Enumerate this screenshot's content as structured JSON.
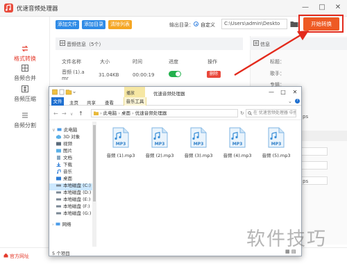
{
  "app": {
    "title": "优速音频处理器",
    "window_buttons": [
      "—",
      "□",
      "✕"
    ]
  },
  "toolbar": {
    "add_file": "添加文件",
    "add_dir": "添加目录",
    "clear_list": "清除列表",
    "output_label": "输出目录：",
    "custom_radio": "自定义",
    "output_path": "C:\\Users\\admin\\Deskto",
    "start_button": "开始转换"
  },
  "sidebar": {
    "items": [
      {
        "label": "格式转换",
        "active": true
      },
      {
        "label": "音频合并",
        "active": false
      },
      {
        "label": "音频压缩",
        "active": false
      },
      {
        "label": "音频分割",
        "active": false
      }
    ],
    "official_site": "官方网址"
  },
  "file_list": {
    "title": "音频信息（5个）",
    "columns": [
      "文件名称",
      "大小",
      "时间",
      "进度",
      "操作"
    ],
    "rows": [
      {
        "name_line1": "音频 (1).a",
        "name_line2": "mr",
        "size": "31.04KB",
        "time": "00:00:19",
        "action": "删除"
      }
    ]
  },
  "info_panel": {
    "title": "信息",
    "labels": [
      "标题：",
      "歌手：",
      "专辑："
    ],
    "partial_values": [
      "",
      "",
      "",
      "ps",
      "",
      "ps"
    ]
  },
  "explorer": {
    "quick_access_label": "▾",
    "tool_group": "播放",
    "title": "优速音频处理器",
    "ribbon_tabs": [
      "文件",
      "主页",
      "共享",
      "查看",
      "音乐工具"
    ],
    "address_parts": [
      "此电脑",
      "桌面",
      "优速音频处理器"
    ],
    "search_placeholder": "在 优速音频处理器 中搜索",
    "tree": [
      "此电脑",
      "3D 对象",
      "视频",
      "图片",
      "文档",
      "下载",
      "音乐",
      "桌面",
      "本地磁盘 (C:)",
      "本地磁盘 (D:)",
      "本地磁盘 (E:)",
      "本地磁盘 (F:)",
      "本地磁盘 (G:)",
      "网络"
    ],
    "files": [
      "音频 (1).mp3",
      "音频 (2).mp3",
      "音频 (3).mp3",
      "音频 (4).mp3",
      "音频 (5).mp3"
    ],
    "file_icon_text": "MP3",
    "status": "5 个项目"
  },
  "watermark": "软件技巧",
  "colors": {
    "accent_red": "#e43b2c",
    "start_orange": "#ee5a24",
    "button_blue": "#2f8be6",
    "button_orange": "#f5a623",
    "toggle_green": "#23b14d",
    "explorer_blue": "#1e6fd0"
  }
}
